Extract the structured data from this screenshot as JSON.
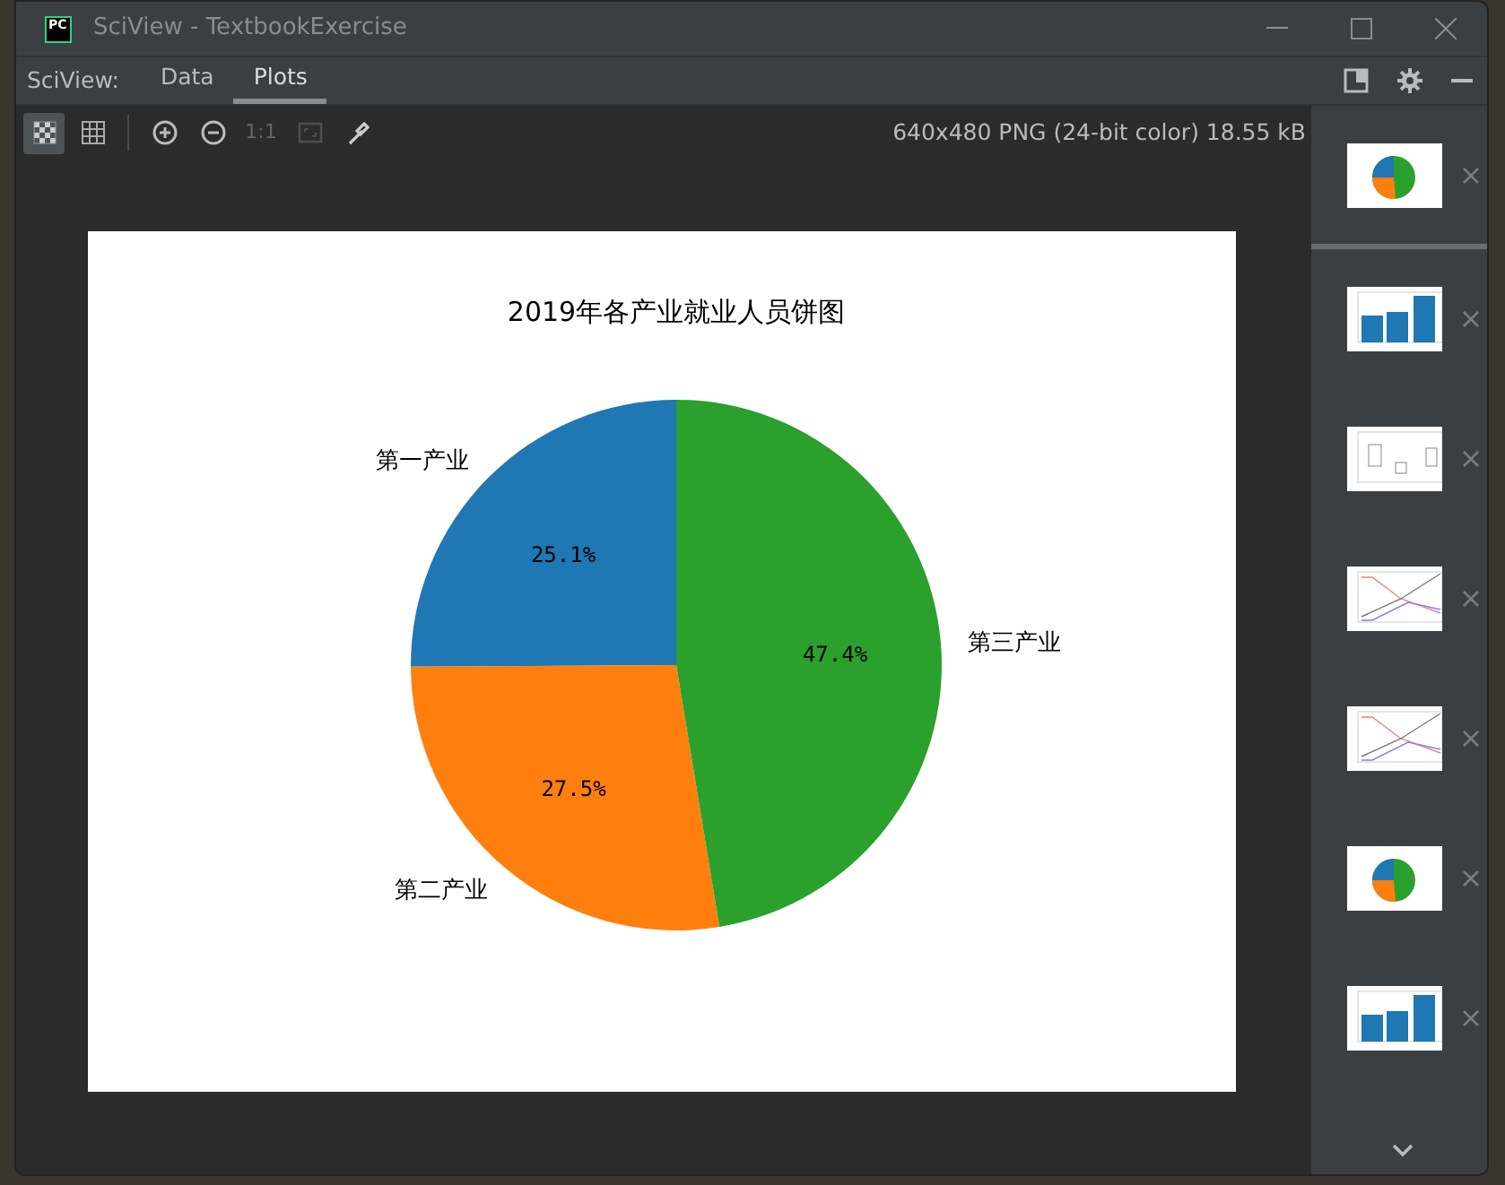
{
  "window": {
    "title": "SciView - TextbookExercise",
    "logo": "PC"
  },
  "panel_label": "SciView:",
  "tabs": [
    {
      "label": "Data",
      "selected": false
    },
    {
      "label": "Plots",
      "selected": true
    }
  ],
  "toolbar": {
    "tools": [
      {
        "kind": "checker",
        "selected": true
      },
      {
        "kind": "grid",
        "selected": false
      },
      {
        "kind": "sep"
      },
      {
        "kind": "zoom-in",
        "selected": false
      },
      {
        "kind": "zoom-out",
        "selected": false
      },
      {
        "kind": "text",
        "label": "1:1",
        "disabled": true
      },
      {
        "kind": "fit",
        "disabled": true
      },
      {
        "kind": "picker",
        "selected": false
      }
    ],
    "image_info": "640x480 PNG (24-bit color) 18.55 kB"
  },
  "plot": {
    "chart_data": {
      "type": "pie",
      "title": "2019年各产业就业人员饼图",
      "categories": [
        "第一产业",
        "第二产业",
        "第三产业"
      ],
      "values": [
        25.1,
        27.5,
        47.4
      ],
      "colors": [
        "#1f77b4",
        "#ff7f0e",
        "#2ca02c"
      ],
      "value_labels": [
        "25.1%",
        "27.5%",
        "47.4%"
      ]
    }
  },
  "thumbnails": [
    {
      "kind": "pie",
      "selected": true
    },
    {
      "kind": "bar",
      "selected": false
    },
    {
      "kind": "box",
      "selected": false
    },
    {
      "kind": "line",
      "selected": false
    },
    {
      "kind": "line",
      "selected": false
    },
    {
      "kind": "pie",
      "selected": false
    },
    {
      "kind": "bar",
      "selected": false
    }
  ]
}
